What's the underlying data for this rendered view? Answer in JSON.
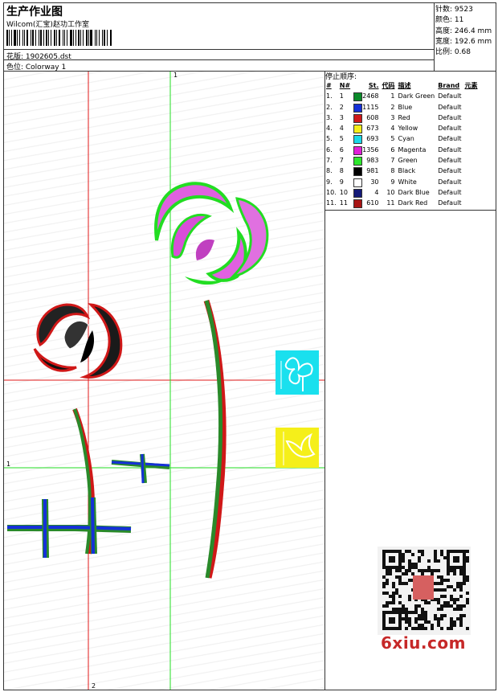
{
  "header": {
    "title": "生产作业图",
    "studio": "Wilcom(汇宝)赵功工作室",
    "pattern": "花版: 1902605.dst",
    "colorway": "色位: Colorway 1"
  },
  "stats": [
    {
      "label": "针数:",
      "value": "9523"
    },
    {
      "label": "颜色:",
      "value": "11"
    },
    {
      "label": "高度:",
      "value": "246.4 mm"
    },
    {
      "label": "宽度:",
      "value": "192.6 mm"
    },
    {
      "label": "比例:",
      "value": "0.68"
    }
  ],
  "stop_sequence": {
    "title": "停止顺序:",
    "columns": [
      "#",
      "N#",
      "St.",
      "代码",
      "描述",
      "Brand",
      "元素"
    ],
    "rows": [
      {
        "idx": "1.",
        "n": "1",
        "color": "#0a8a2a",
        "st": "2468",
        "code": "1",
        "desc": "Dark Green",
        "brand": "Default"
      },
      {
        "idx": "2.",
        "n": "2",
        "color": "#1530d8",
        "st": "1115",
        "code": "2",
        "desc": "Blue",
        "brand": "Default"
      },
      {
        "idx": "3.",
        "n": "3",
        "color": "#d01818",
        "st": "608",
        "code": "3",
        "desc": "Red",
        "brand": "Default"
      },
      {
        "idx": "4.",
        "n": "4",
        "color": "#f5ef1a",
        "st": "673",
        "code": "4",
        "desc": "Yellow",
        "brand": "Default"
      },
      {
        "idx": "5.",
        "n": "5",
        "color": "#1ad8e8",
        "st": "693",
        "code": "5",
        "desc": "Cyan",
        "brand": "Default"
      },
      {
        "idx": "6.",
        "n": "6",
        "color": "#e020d8",
        "st": "1356",
        "code": "6",
        "desc": "Magenta",
        "brand": "Default"
      },
      {
        "idx": "7.",
        "n": "7",
        "color": "#2ee82e",
        "st": "983",
        "code": "7",
        "desc": "Green",
        "brand": "Default"
      },
      {
        "idx": "8.",
        "n": "8",
        "color": "#000000",
        "st": "981",
        "code": "8",
        "desc": "Black",
        "brand": "Default"
      },
      {
        "idx": "9.",
        "n": "9",
        "color": "#ffffff",
        "st": "30",
        "code": "9",
        "desc": "White",
        "brand": "Default"
      },
      {
        "idx": "10.",
        "n": "10",
        "color": "#141a78",
        "st": "4",
        "code": "10",
        "desc": "Dark Blue",
        "brand": "Default"
      },
      {
        "idx": "11.",
        "n": "11",
        "color": "#a81414",
        "st": "610",
        "code": "11",
        "desc": "Dark Red",
        "brand": "Default"
      }
    ]
  },
  "guides": {
    "h1": "1",
    "h2": "2",
    "v1": "1",
    "v2": "2"
  },
  "watermark": "6xiu.com"
}
